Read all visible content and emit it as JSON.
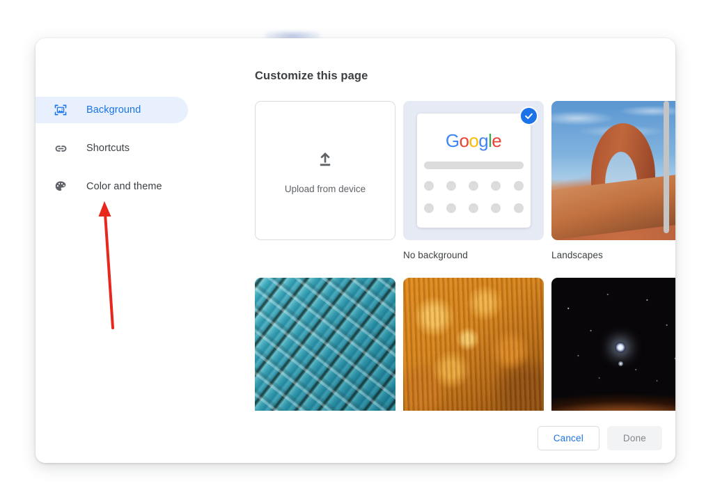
{
  "dialog": {
    "title": "Customize this page"
  },
  "sidebar": {
    "items": [
      {
        "label": "Background",
        "icon": "image-frame-icon",
        "selected": true
      },
      {
        "label": "Shortcuts",
        "icon": "link-icon",
        "selected": false
      },
      {
        "label": "Color and theme",
        "icon": "palette-icon",
        "selected": false
      }
    ]
  },
  "main": {
    "upload": {
      "label": "Upload from device",
      "icon": "upload-icon"
    },
    "tiles": [
      {
        "caption": "No background",
        "kind": "no-background",
        "selected": true,
        "logo": "Google"
      },
      {
        "caption": "Landscapes",
        "kind": "photo-landscape",
        "selected": false
      },
      {
        "caption": "",
        "kind": "photo-architecture",
        "selected": false
      },
      {
        "caption": "",
        "kind": "photo-texture",
        "selected": false
      },
      {
        "caption": "",
        "kind": "photo-space",
        "selected": false
      }
    ],
    "logo_letters": [
      "G",
      "o",
      "o",
      "g",
      "l",
      "e"
    ]
  },
  "footer": {
    "cancel_label": "Cancel",
    "done_label": "Done",
    "done_disabled": true
  },
  "annotation": {
    "type": "arrow",
    "color": "#e8271c",
    "points_to": "Color and theme"
  },
  "colors": {
    "accent": "#1a73e8",
    "selected_pill_bg": "#e8f0fe",
    "text_primary": "#3c4043",
    "text_secondary": "#5f6368",
    "border": "#dadce0",
    "disabled_bg": "#f1f3f4",
    "disabled_text": "#80868b",
    "annotation_red": "#e8271c"
  }
}
